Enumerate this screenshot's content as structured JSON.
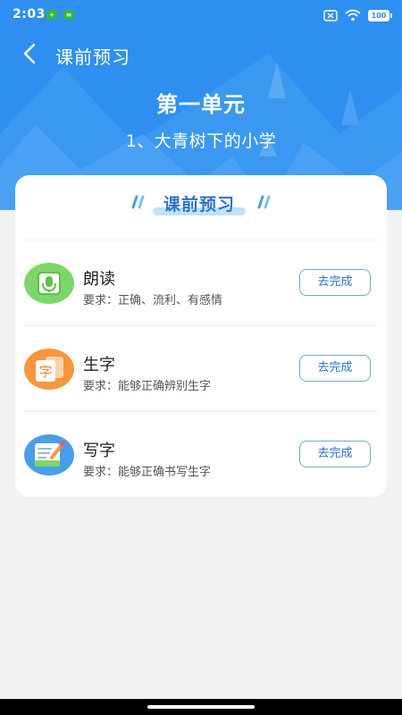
{
  "status_bar": {
    "time": "2:03",
    "battery": "100",
    "icons": [
      "notification-app-icon",
      "notification-app-icon",
      "close-box-icon",
      "wifi-icon",
      "battery-icon"
    ]
  },
  "nav": {
    "title": "课前预习",
    "back_icon": "chevron-left-icon"
  },
  "unit": {
    "title": "第一单元",
    "lesson": "1、大青树下的小学"
  },
  "section": {
    "title": "课前预习"
  },
  "tasks": [
    {
      "name": "朗读",
      "requirement": "要求：正确、流利、有感情",
      "button": "去完成",
      "icon": "microphone-icon",
      "color": "#7ed66b"
    },
    {
      "name": "生字",
      "requirement": "要求：能够正确辨别生字",
      "button": "去完成",
      "icon": "character-card-icon",
      "character": "字",
      "color": "#f6973d"
    },
    {
      "name": "写字",
      "requirement": "要求：能够正确书写生字",
      "button": "去完成",
      "icon": "writing-icon",
      "color": "#4a9ee8"
    }
  ],
  "colors": {
    "header": "#2e8ff0",
    "accent": "#2f73c9",
    "background": "#f2f2f4"
  }
}
